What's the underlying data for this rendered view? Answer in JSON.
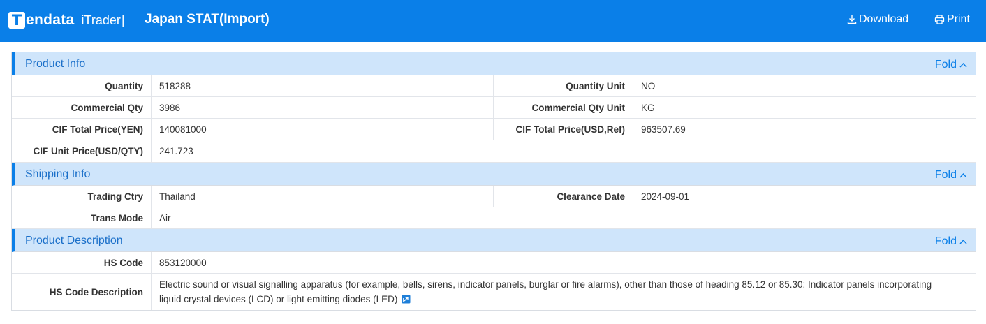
{
  "header": {
    "brand": "endata",
    "brand_letter": "T",
    "product": "iTrader",
    "separator": "|",
    "title": "Japan STAT(Import)",
    "download_label": "Download",
    "print_label": "Print",
    "bg_color": "#0a7fe8"
  },
  "fold_label": "Fold",
  "product_info": {
    "title": "Product Info",
    "quantity_label": "Quantity",
    "quantity_value": "518288",
    "quantity_unit_label": "Quantity Unit",
    "quantity_unit_value": "NO",
    "commercial_qty_label": "Commercial Qty",
    "commercial_qty_value": "3986",
    "commercial_qty_unit_label": "Commercial Qty Unit",
    "commercial_qty_unit_value": "KG",
    "cif_total_yen_label": "CIF Total Price(YEN)",
    "cif_total_yen_value": "140081000",
    "cif_total_usd_label": "CIF Total Price(USD,Ref)",
    "cif_total_usd_value": "963507.69",
    "cif_unit_price_label": "CIF Unit Price(USD/QTY)",
    "cif_unit_price_value": "241.723"
  },
  "shipping_info": {
    "title": "Shipping Info",
    "trading_ctry_label": "Trading Ctry",
    "trading_ctry_value": "Thailand",
    "clearance_date_label": "Clearance Date",
    "clearance_date_value": "2024-09-01",
    "trans_mode_label": "Trans Mode",
    "trans_mode_value": "Air"
  },
  "product_description": {
    "title": "Product Description",
    "hs_code_label": "HS Code",
    "hs_code_value": "853120000",
    "hs_desc_label": "HS Code Description",
    "hs_desc_value": "Electric sound or visual signalling apparatus (for example, bells, sirens, indicator panels, burglar or fire alarms), other than those of heading 85.12 or 85.30: Indicator panels incorporating liquid crystal devices (LCD) or light emitting diodes (LED)"
  },
  "icons": {
    "download": "download-icon",
    "print": "printer-icon",
    "fold": "chevron-up-icon",
    "link": "external-link-icon"
  }
}
